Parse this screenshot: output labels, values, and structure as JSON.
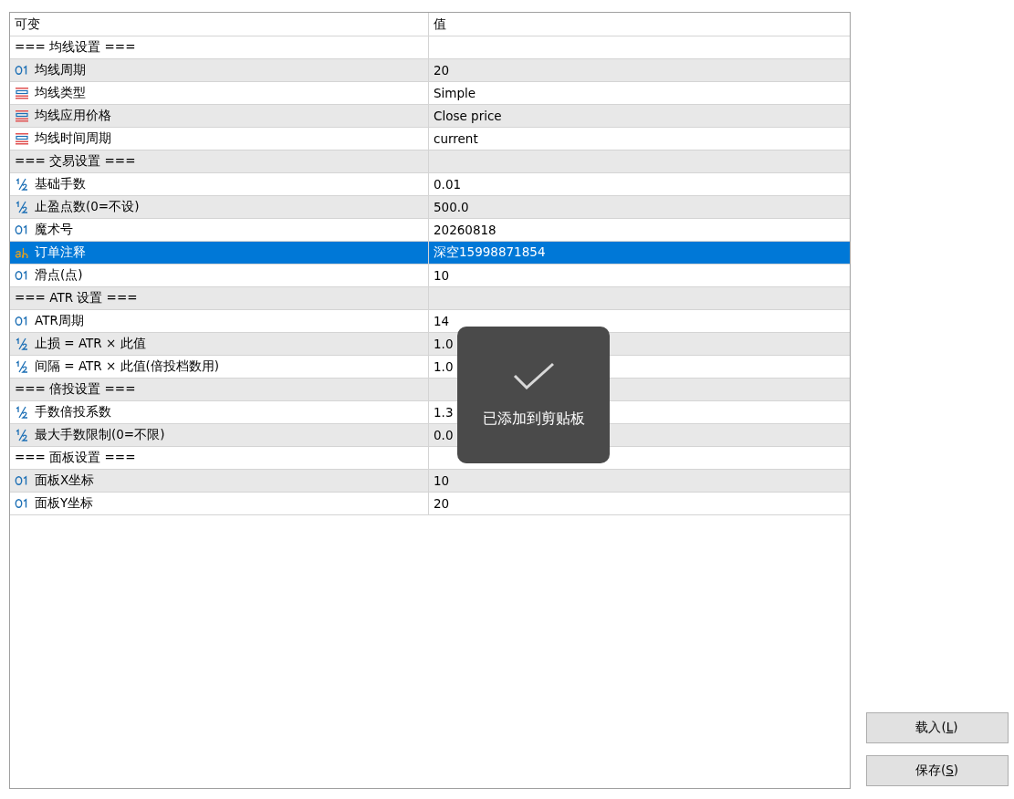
{
  "table": {
    "columns": [
      "可变",
      "值"
    ],
    "rows": [
      {
        "kind": "section",
        "name": "=== 均线设置 ===",
        "value": "",
        "selected": false
      },
      {
        "kind": "int",
        "name": "均线周期",
        "value": "20",
        "selected": false
      },
      {
        "kind": "enum",
        "name": "均线类型",
        "value": "Simple",
        "selected": false
      },
      {
        "kind": "enum",
        "name": "均线应用价格",
        "value": "Close price",
        "selected": false
      },
      {
        "kind": "enum",
        "name": "均线时间周期",
        "value": "current",
        "selected": false
      },
      {
        "kind": "section",
        "name": "=== 交易设置 ===",
        "value": "",
        "selected": false
      },
      {
        "kind": "double",
        "name": "基础手数",
        "value": "0.01",
        "selected": false
      },
      {
        "kind": "double",
        "name": "止盈点数(0=不设)",
        "value": "500.0",
        "selected": false
      },
      {
        "kind": "int",
        "name": "魔术号",
        "value": "20260818",
        "selected": false
      },
      {
        "kind": "string",
        "name": "订单注释",
        "value": "深空15998871854",
        "selected": true
      },
      {
        "kind": "int",
        "name": "滑点(点)",
        "value": "10",
        "selected": false
      },
      {
        "kind": "section",
        "name": "=== ATR 设置 ===",
        "value": "",
        "selected": false
      },
      {
        "kind": "int",
        "name": "ATR周期",
        "value": "14",
        "selected": false
      },
      {
        "kind": "double",
        "name": "止损 = ATR × 此值",
        "value": "1.0",
        "selected": false
      },
      {
        "kind": "double",
        "name": "间隔 = ATR × 此值(倍投档数用)",
        "value": "1.0",
        "selected": false
      },
      {
        "kind": "section",
        "name": "=== 倍投设置 ===",
        "value": "",
        "selected": false
      },
      {
        "kind": "double",
        "name": "手数倍投系数",
        "value": "1.3",
        "selected": false
      },
      {
        "kind": "double",
        "name": "最大手数限制(0=不限)",
        "value": "0.0",
        "selected": false
      },
      {
        "kind": "section",
        "name": "=== 面板设置 ===",
        "value": "",
        "selected": false
      },
      {
        "kind": "int",
        "name": "面板X坐标",
        "value": "10",
        "selected": false
      },
      {
        "kind": "int",
        "name": "面板Y坐标",
        "value": "20",
        "selected": false
      }
    ]
  },
  "toast": {
    "message": "已添加到剪贴板"
  },
  "buttons": [
    {
      "before": "载入(",
      "accelerator": "L",
      "after": ")"
    },
    {
      "before": "保存(",
      "accelerator": "S",
      "after": ")"
    }
  ]
}
